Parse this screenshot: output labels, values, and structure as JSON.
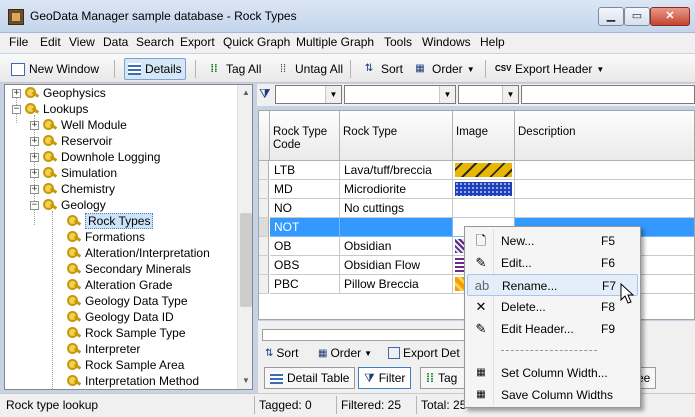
{
  "window": {
    "title": "GeoData Manager  sample database - Rock Types"
  },
  "menu": [
    "File",
    "Edit",
    "View",
    "Data",
    "Search",
    "Export",
    "Quick Graph",
    "Multiple Graph",
    "Tools",
    "Windows",
    "Help"
  ],
  "toolbar": {
    "new_window": "New Window",
    "details": "Details",
    "tag_all": "Tag All",
    "untag_all": "Untag All",
    "sort": "Sort",
    "order": "Order",
    "export_header": "Export Header"
  },
  "tree": {
    "items": [
      {
        "label": "Geophysics"
      },
      {
        "label": "Lookups"
      },
      {
        "label": "Well Module"
      },
      {
        "label": "Reservoir"
      },
      {
        "label": "Downhole Logging"
      },
      {
        "label": "Simulation"
      },
      {
        "label": "Chemistry"
      },
      {
        "label": "Geology"
      },
      {
        "label": "Rock Types"
      },
      {
        "label": "Formations"
      },
      {
        "label": "Alteration/Interpretation"
      },
      {
        "label": "Secondary Minerals"
      },
      {
        "label": "Alteration Grade"
      },
      {
        "label": "Geology Data Type"
      },
      {
        "label": "Geology Data ID"
      },
      {
        "label": "Rock Sample Type"
      },
      {
        "label": "Interpreter"
      },
      {
        "label": "Rock Sample Area"
      },
      {
        "label": "Interpretation Method"
      }
    ]
  },
  "grid": {
    "columns": [
      "Rock Type Code",
      "Rock Type",
      "Image",
      "Description"
    ],
    "rows": [
      {
        "code": "LTB",
        "type": "Lava/tuff/breccia"
      },
      {
        "code": "MD",
        "type": "Microdiorite"
      },
      {
        "code": "NO",
        "type": "No cuttings"
      },
      {
        "code": "NOT",
        "type": ""
      },
      {
        "code": "OB",
        "type": "Obsidian"
      },
      {
        "code": "OBS",
        "type": "Obsidian Flow"
      },
      {
        "code": "PBC",
        "type": "Pillow Breccia"
      }
    ]
  },
  "lower": {
    "sort": "Sort",
    "order": "Order",
    "export_det": "Export Det",
    "tab_detail": "Detail Table",
    "tab_filter": "Filter",
    "tab_tag": "Tag",
    "tab_ee": "ee"
  },
  "context_menu": {
    "items": [
      {
        "label": "New...",
        "shortcut": "F5"
      },
      {
        "label": "Edit...",
        "shortcut": "F6"
      },
      {
        "label": "Rename...",
        "shortcut": "F7"
      },
      {
        "label": "Delete...",
        "shortcut": "F8"
      },
      {
        "label": "Edit Header...",
        "shortcut": "F9"
      },
      {
        "label": "Set Column Width..."
      },
      {
        "label": "Save Column Widths"
      }
    ]
  },
  "status": {
    "left": "Rock type lookup",
    "tagged": "Tagged: 0",
    "filtered": "Filtered: 25",
    "total": "Total: 25"
  }
}
